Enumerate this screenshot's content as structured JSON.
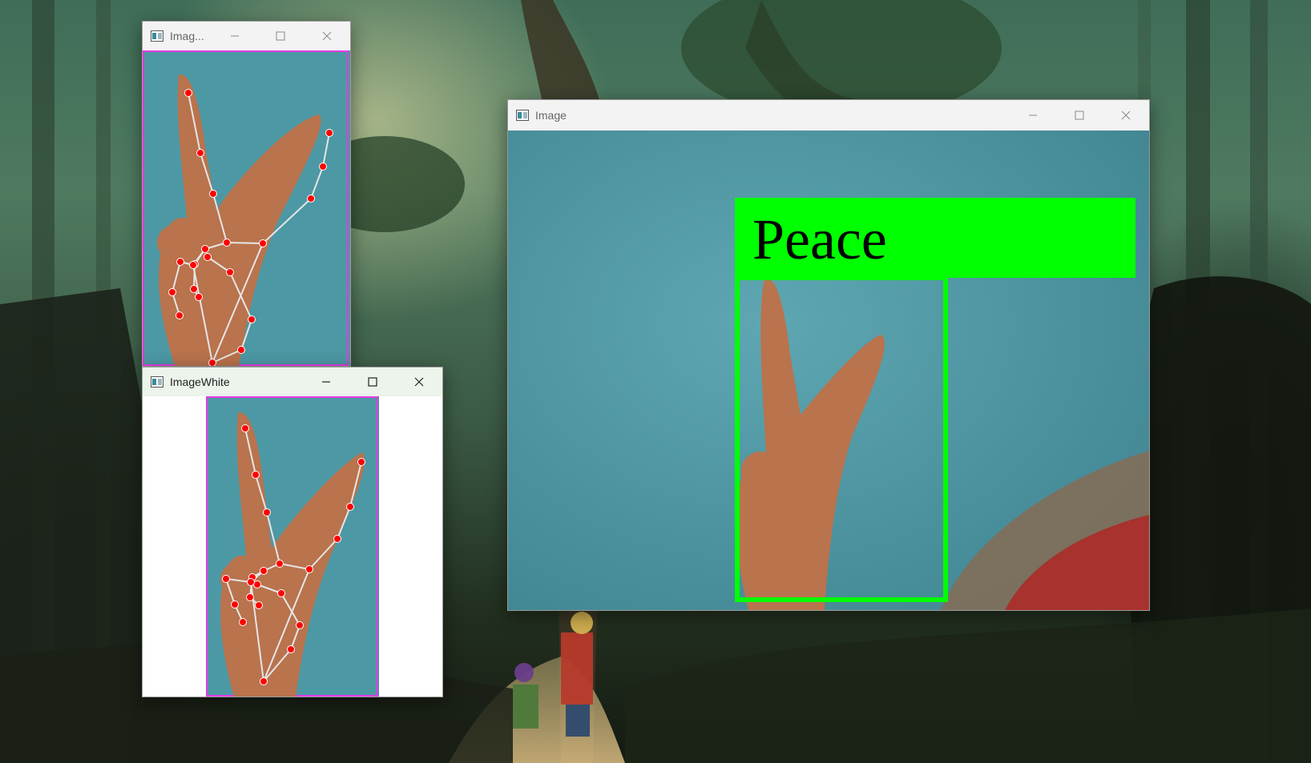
{
  "desktop": {
    "wallpaper": "forest-anime-wallpaper"
  },
  "windows": {
    "image_small": {
      "title": "Imag...",
      "state": "inactive",
      "crop_border_color": "#e23ce2"
    },
    "image_white": {
      "title": "ImageWhite",
      "state": "active",
      "crop_border_color": "#e23ce2"
    },
    "image_main": {
      "title": "Image",
      "state": "inactive",
      "gesture_label": "Peace",
      "box_color": "#00ff00",
      "label_text_color": "#000000"
    }
  },
  "landmarks": {
    "dot_color": "#ff0000",
    "line_color": "#e6e6e6"
  },
  "icons": {
    "app": "opencv-window-icon",
    "minimize": "minimize-icon",
    "maximize": "maximize-icon",
    "close": "close-icon"
  }
}
